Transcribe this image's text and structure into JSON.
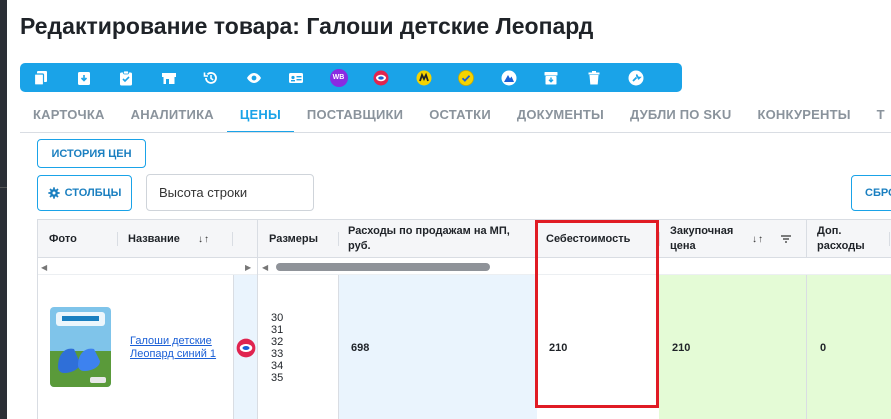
{
  "page": {
    "title": "Редактирование товара: Галоши детские Леопард"
  },
  "toolbar": {
    "buttons": [
      {
        "icon": "copy-icon"
      },
      {
        "icon": "download-icon"
      },
      {
        "icon": "clipboard-check-icon"
      },
      {
        "icon": "store-icon"
      },
      {
        "icon": "history-icon"
      },
      {
        "icon": "eye-icon"
      },
      {
        "icon": "id-card-icon"
      },
      {
        "icon": "wildberries-icon",
        "label": "WB",
        "color": "#8a2be2"
      },
      {
        "icon": "ozon-icon",
        "color": "#e0244f"
      },
      {
        "icon": "yandex-market-icon",
        "color": "#f5d300"
      },
      {
        "icon": "check-badge-icon",
        "color": "#f5d300"
      },
      {
        "icon": "mountain-icon",
        "color": "#1a5fd6"
      },
      {
        "icon": "archive-icon"
      },
      {
        "icon": "trash-icon"
      },
      {
        "icon": "wrench-icon"
      }
    ],
    "color": "#1aa3e8"
  },
  "tabs": [
    {
      "label": "КАРТОЧКА"
    },
    {
      "label": "АНАЛИТИКА"
    },
    {
      "label": "ЦЕНЫ",
      "active": true
    },
    {
      "label": "ПОСТАВЩИКИ"
    },
    {
      "label": "ОСТАТКИ"
    },
    {
      "label": "ДОКУМЕНТЫ"
    },
    {
      "label": "ДУБЛИ ПО SKU"
    },
    {
      "label": "КОНКУРЕНТЫ"
    },
    {
      "label": "Т"
    }
  ],
  "controls": {
    "history_label": "ИСТОРИЯ ЦЕН",
    "columns_label": "СТОЛБЦЫ",
    "row_height_value": "Высота строки",
    "reset_label": "СБРО"
  },
  "table": {
    "headers": {
      "photo": "Фото",
      "name": "Название",
      "name_sort": "↓↑",
      "sizes": "Размеры",
      "mp_costs": "Расходы по продажам на МП, руб.",
      "cost_price": "Себестоимость",
      "purchase_price": "Закупочная цена",
      "purchase_sort": "↓↑",
      "extra_costs": "Доп. расходы"
    },
    "row": {
      "name": "Галоши детские Леопард синий 1",
      "marketplace_icon": "ozon-icon",
      "sizes": [
        "30",
        "31",
        "32",
        "33",
        "34",
        "35"
      ],
      "mp_costs": "698",
      "cost_price": "210",
      "purchase_price": "210",
      "extra_costs": "0"
    },
    "highlight_color": "#e01b24",
    "green_cell_color": "#e4fbd6",
    "blue_cell_color": "#eaf4fd"
  }
}
